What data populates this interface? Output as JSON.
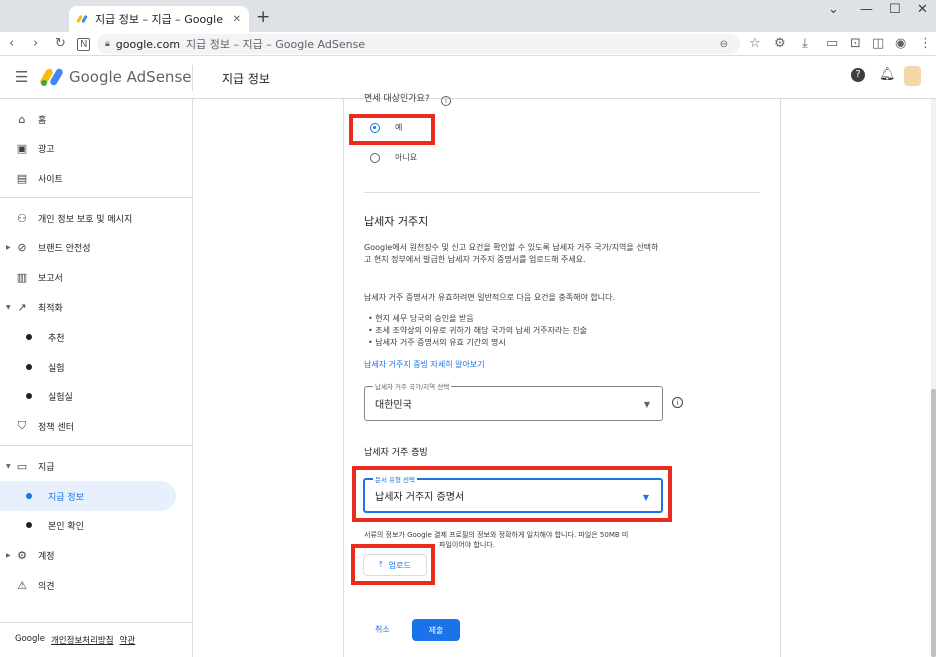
{
  "browser": {
    "tab_title": "지급 정보 – 지급 – Google AdSe",
    "new_tab": "+",
    "address_domain": "google.com",
    "address_rest": "지급 정보 – 지급 – Google AdSense"
  },
  "appbar": {
    "product": "Google AdSense",
    "page_title": "지급 정보"
  },
  "sidebar": {
    "items": [
      {
        "label": "홈"
      },
      {
        "label": "광고"
      },
      {
        "label": "사이트"
      },
      {
        "label": "개인 정보 보호 및 메시지"
      },
      {
        "label": "브랜드 안전성"
      },
      {
        "label": "보고서"
      },
      {
        "label": "최적화"
      },
      {
        "label": "추천"
      },
      {
        "label": "실험"
      },
      {
        "label": "실험실"
      },
      {
        "label": "정책 센터"
      },
      {
        "label": "지급"
      },
      {
        "label": "지급 정보"
      },
      {
        "label": "본인 확인"
      },
      {
        "label": "계정"
      },
      {
        "label": "의견"
      }
    ],
    "footer": {
      "google": "Google",
      "privacy": "개인정보처리방침",
      "terms": "약관"
    }
  },
  "form": {
    "question_partial": "면세 대상인가요?",
    "option_yes": "예",
    "option_no": "아니요",
    "residence_title": "납세자 거주지",
    "residence_desc": "Google에서 원천징수 및 신고 요건을 확인할 수 있도록 납세자 거주 국가/지역을 선택하고 현지 정부에서 발급한 납세자 거주지 증명서를 업로드해 주세요.",
    "req_intro": "납세자 거주 증명서가 유효하려면 일반적으로 다음 요건을 충족해야 합니다.",
    "requirements": [
      "현지 세무 당국의 승인을 받음",
      "조세 조약상의 이유로 귀하가 해당 국가의 납세 거주자라는 진술",
      "납세자 거주 증명서의 유효 기간의 명시"
    ],
    "learn_more": "납세자 거주지 증빙 자세히 알아보기",
    "country_label": "납세자 거주 국가/지역 선택",
    "country_value": "대한민국",
    "proof_title": "납세자 거주 증빙",
    "doc_label": "문서 유형 선택",
    "doc_value": "납세자 거주지 증명서",
    "upload_note_a": "서류의 정보가 Google 결제 프로필의 정보와 정확하게 일치해야 합니다. 파일은 50MB 미",
    "upload_note_b": "파일이어야 합니다.",
    "upload_button": "업로드",
    "cancel": "취소",
    "submit": "제출"
  },
  "colors": {
    "accent": "#1a73e8",
    "highlight": "#ea2b1f"
  }
}
